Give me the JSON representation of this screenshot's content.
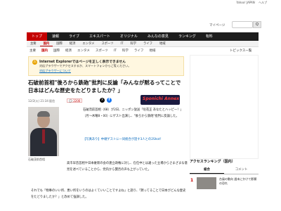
{
  "top_links": [
    "Yahoo! JAPAN",
    "ヘルプ"
  ],
  "header": {
    "mypage": "マイページ",
    "search_button": "Q"
  },
  "main_nav": [
    "トップ",
    "速報",
    "ライブ",
    "エキスパート",
    "オリジナル",
    "みんなの意見",
    "ランキング",
    "有料"
  ],
  "sub_nav": [
    "主要",
    "国内",
    "国際",
    "経済",
    "エンタメ",
    "スポーツ",
    "IT",
    "科学",
    "ライフ",
    "地域"
  ],
  "cat_tabs": [
    "主要",
    "国内",
    "国際",
    "経済",
    "エンタメ",
    "スポーツ",
    "IT",
    "科学",
    "ライフ",
    "地域"
  ],
  "topics_link": "トピックス一覧",
  "notice": {
    "icon": "⚠",
    "title": "Internet Explorerではページを正しく表示できません",
    "text": "対応ブラウザーでアクセスするか、スマートフォンからご覧ください。",
    "link": "対応ブラウザーについて"
  },
  "article": {
    "headline": "石破前首相\"後ろから鉄砲\"批判に反論「みんなが黙るってことで日本はどんな歴史をたどりましたか？」",
    "date": "12/2(火) 21:34 配信",
    "comments": "2200",
    "media_logo": "Sponichi Annex",
    "photo_caption": "石破茂前首相",
    "para1": "石破茂前首相（68）が2日、ニッポン放送「垣花正 あなたとハッピー！」（月〜木曜8・00）にゲスト出演し、\"後ろから鉄砲\"批判に反論した。",
    "related": "【写真あり】中継ゲストに一同統合が話す3人との2Shot！",
    "para2": "高市早苗首相や日本維新の会の連立政権に対し、在任中とは違った立場からさまざまな意見を述べていることから、党内から賛否の声も上がっていた。",
    "para3": "それでも「物事のいい所、悪い所をいうのはよくていいことですよね」と語り、「黙ってることで日本がどんな歴史をたどりましたか？」と改めて強調した。"
  },
  "ranking": {
    "title": "アクセスランキング（国内）",
    "tabs": [
      "総合",
      "コメント"
    ],
    "items": [
      {
        "num": "1",
        "text": "台風の動向 週末にかけて影響の恐れ"
      }
    ]
  }
}
